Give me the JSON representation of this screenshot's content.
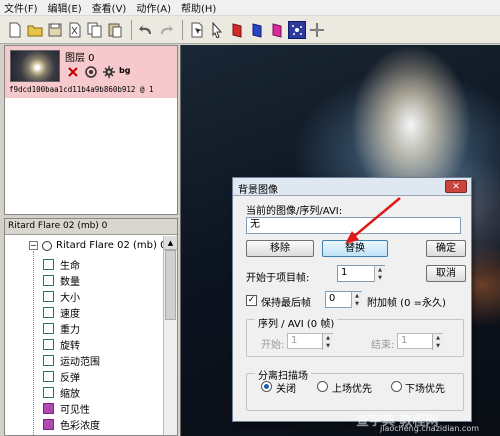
{
  "menu": [
    "文件(F)",
    "编辑(E)",
    "查看(V)",
    "动作(A)",
    "帮助(H)"
  ],
  "toolbar": {
    "icons": [
      "new-icon",
      "open-icon",
      "save-icon",
      "cut-icon",
      "copy-icon",
      "paste-icon",
      "undo-icon",
      "redo-icon",
      "select-icon",
      "pointer-icon",
      "red-layer-icon",
      "blue-layer-icon",
      "pink-layer-icon",
      "particle-icon",
      "transform-icon"
    ],
    "colors": {
      "red": "#d12a2a",
      "blue": "#2b44c8",
      "pink": "#d82a9a",
      "active": "#2d3b9c"
    }
  },
  "layer": {
    "name": "图层 0",
    "hash": "f9dcd100baa1cd11b4a9b860b912  @ 1",
    "tag": "bg",
    "highlight": "#f6c9cc"
  },
  "tree": {
    "header": "Ritard Flare 02 (mb) 0",
    "root": "Ritard Flare 02 (mb) 0",
    "items": [
      "生命",
      "数量",
      "大小",
      "速度",
      "重力",
      "旋转",
      "运动范围",
      "反弹",
      "缩放",
      "可见性",
      "色彩浓度"
    ],
    "item_color": "#2c6e6e",
    "item_colors_alt": [
      "#2c6e6e",
      "#2c6e6e",
      "#2c6e6e",
      "#2c6e6e",
      "#2c6e6e",
      "#2c6e6e",
      "#2c6e6e",
      "#2c6e6e",
      "#2c6e6e",
      "#b04ab0",
      "#b04ab0"
    ]
  },
  "dialog": {
    "title": "背景图像",
    "close": "✕",
    "current_label": "当前的图像/序列/AVI:",
    "current_value": "无",
    "remove_btn": "移除",
    "replace_btn": "替换",
    "ok_btn": "确定",
    "cancel_btn": "取消",
    "start_frame_label": "开始于项目帧:",
    "start_frame_value": "1",
    "hold_last_label": "保持最后帧",
    "hold_last_checked": true,
    "extra_frames_value": "0",
    "extra_frames_label": "附加帧  (0 =永久)",
    "sequence_group": "序列 / AVI    (0 帧)",
    "seq_start_label": "开始:",
    "seq_start_value": "1",
    "seq_end_label": "结束:",
    "seq_end_value": "1",
    "field_group": "分离扫描场",
    "field_options": [
      "关闭",
      "上场优先",
      "下场优先"
    ],
    "field_selected": 0
  },
  "watermark": {
    "text": "查字典 教程网",
    "url": "jiaocheng.chazidian.com"
  }
}
